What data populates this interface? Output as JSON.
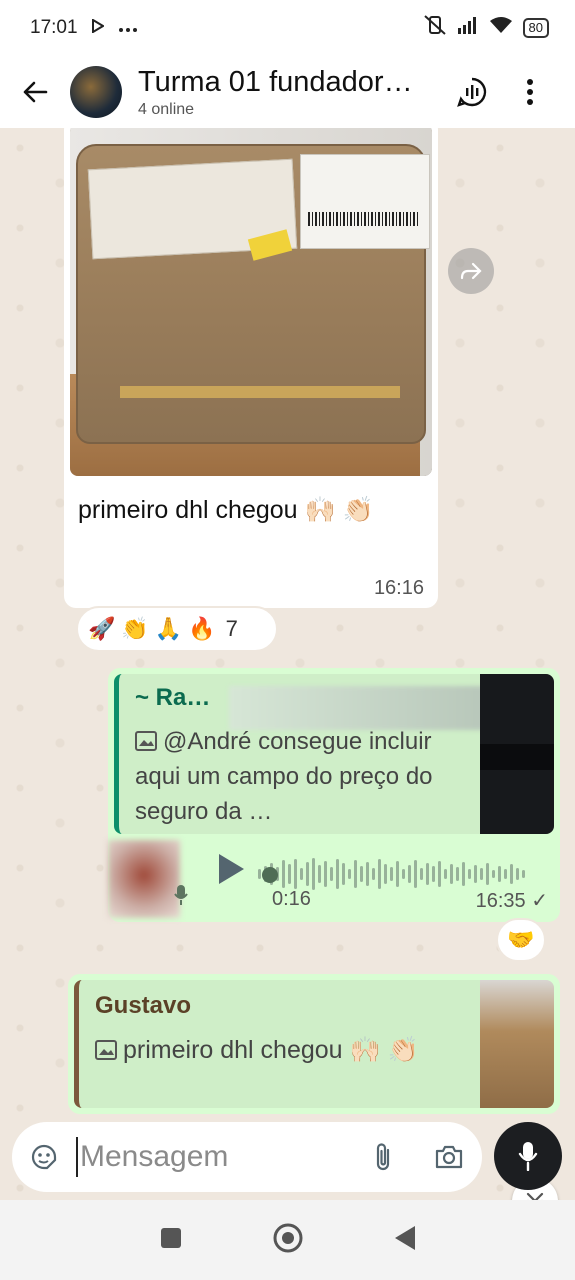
{
  "status_bar": {
    "time": "17:01",
    "battery": "80"
  },
  "header": {
    "title": "Turma 01 fundador…",
    "subtitle": "4 online"
  },
  "messages": {
    "incoming": {
      "caption": "primeiro dhl chegou 🙌🏻 👏🏻",
      "time": "16:16",
      "reactions": [
        "🚀",
        "👏",
        "🙏",
        "🔥"
      ],
      "reaction_count": "7"
    },
    "outgoing_voice": {
      "quote_author": "~ Ra…",
      "quote_text": "@André consegue incluir aqui um campo do preço do seguro da …",
      "duration": "0:16",
      "time": "16:35 ✓",
      "reaction": "🤝"
    },
    "outgoing_reply": {
      "quote_author": "Gustavo",
      "quote_text": "primeiro dhl chegou 🙌🏻 👏🏻"
    }
  },
  "composer": {
    "placeholder": "Mensagem"
  },
  "colors": {
    "outgoing_bubble": "#d9fdd3",
    "chat_background": "#efe7de",
    "quote_accent_green": "#0d8f6a",
    "quote_accent_brown": "#7c5a3c"
  }
}
